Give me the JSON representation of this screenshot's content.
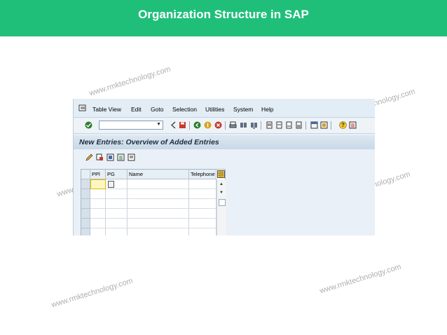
{
  "slide": {
    "title": "Organization Structure in SAP",
    "watermark": "www.rmktechnology.com"
  },
  "menubar": {
    "items": [
      "Table View",
      "Edit",
      "Goto",
      "Selection",
      "Utilities",
      "System",
      "Help"
    ]
  },
  "screen": {
    "title": "New Entries: Overview of Added Entries"
  },
  "table": {
    "columns": [
      "PPl",
      "PG",
      "Name",
      "Telephone"
    ],
    "rows": 6
  },
  "colors": {
    "header_green": "#1fbf7a",
    "sap_background": "#e9f0f7"
  }
}
